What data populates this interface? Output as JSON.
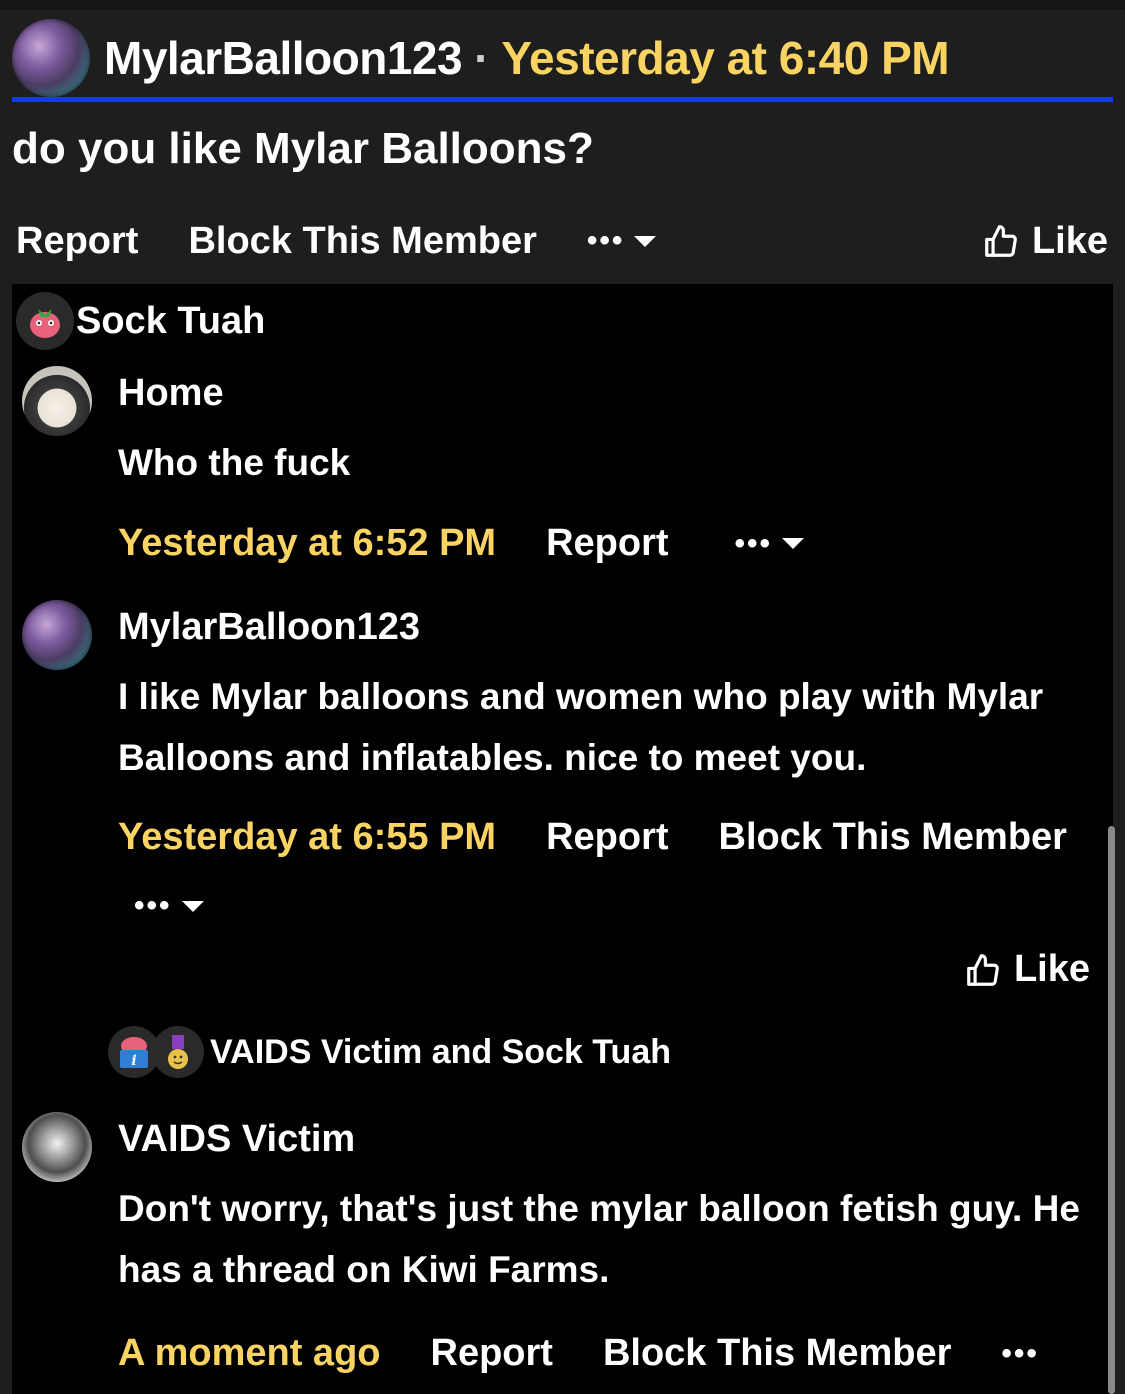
{
  "post": {
    "author": "MylarBalloon123",
    "separator": "·",
    "time": "Yesterday at 6:40 PM",
    "body": "do you like Mylar Balloons?",
    "actions": {
      "report": "Report",
      "block": "Block This Member",
      "more": "•••",
      "like": "Like"
    }
  },
  "top_reactions": {
    "names": "Sock Tuah"
  },
  "comments": [
    {
      "author": "Home",
      "text": "Who the fuck",
      "time": "Yesterday at 6:52 PM",
      "report": "Report",
      "more": "•••"
    },
    {
      "author": "MylarBalloon123",
      "text": "I like Mylar balloons and women who play with Mylar Balloons and inflatables. nice to meet you.",
      "time": "Yesterday at 6:55 PM",
      "report": "Report",
      "block": "Block This Member",
      "more": "•••",
      "like": "Like",
      "reactions": "VAIDS Victim and Sock Tuah"
    },
    {
      "author": "VAIDS Victim",
      "text": "Don't worry, that's just the mylar balloon fetish guy. He has a thread on Kiwi Farms.",
      "time": "A moment ago",
      "report": "Report",
      "block": "Block This Member",
      "more": "•••"
    }
  ],
  "colors": {
    "background": "#1e1e1e",
    "panel": "#000000",
    "accent_time": "#f9d462",
    "header_rule": "#1436ff"
  },
  "icons": [
    "balloon-avatar-icon",
    "thumbs-up-icon",
    "chevron-down-icon",
    "strawberry-reaction-icon",
    "book-info-reaction-icon",
    "medal-reaction-icon"
  ]
}
